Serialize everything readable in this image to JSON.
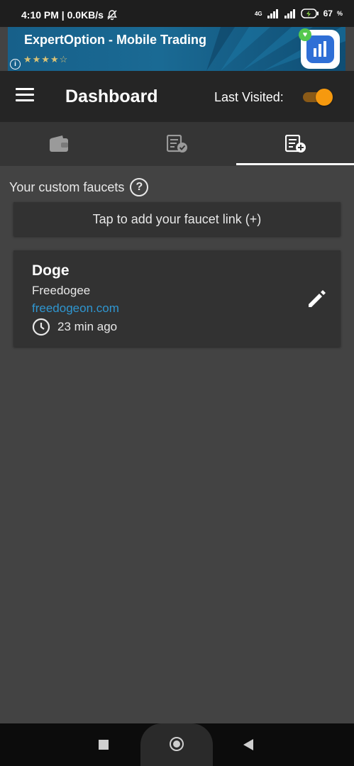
{
  "status_bar": {
    "time": "4:10 PM | 0.0KB/s",
    "network": "4G",
    "battery": "67"
  },
  "ad": {
    "title": "ExpertOption - Mobile Trading",
    "stars": "★★★★☆",
    "info_icon": "i",
    "app_icon": "expertoption-logo-icon"
  },
  "app_bar": {
    "title": "Dashboard",
    "last_visited_label": "Last Visited:",
    "last_visited_enabled": true,
    "accent": "#f6990e"
  },
  "tabs": [
    {
      "icon": "wallet-icon",
      "selected": false
    },
    {
      "icon": "list-check-icon",
      "selected": false
    },
    {
      "icon": "list-add-icon",
      "selected": true
    }
  ],
  "section": {
    "title": "Your custom faucets",
    "help_icon": "?"
  },
  "add_faucet_label": "Tap to add your faucet link (+)",
  "faucets": [
    {
      "name": "Doge",
      "subtitle": "Freedogee",
      "link": "freedogeon.com",
      "time": "23 min ago",
      "link_color": "#2f96d0"
    }
  ]
}
